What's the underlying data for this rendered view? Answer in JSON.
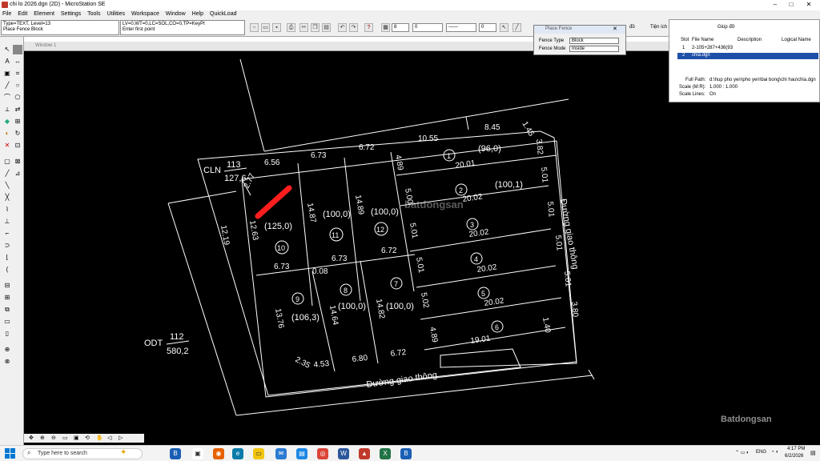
{
  "window": {
    "title": "chi lo 2026.dgn (2D) - MicroStation SE"
  },
  "menu": [
    "File",
    "Edit",
    "Element",
    "Settings",
    "Tools",
    "Utilities",
    "Workspace",
    "Window",
    "Help",
    "QuickLoad"
  ],
  "status": {
    "line1": "Type=TEXT, Level=13",
    "line2": "Place Fence Block",
    "line3": "LV=0,WT=0,LC=SOL,CO=0,TP=KeyPt",
    "line4": "Enter first point"
  },
  "toolbar": {
    "weight_value": "0",
    "color_value": "0",
    "level_value": "8"
  },
  "view": {
    "title": "Window 1"
  },
  "fence_dialog": {
    "title": "Place Fence",
    "type_label": "Fence Type",
    "type_value": "Block",
    "mode_label": "Fence Mode",
    "mode_value": "Inside"
  },
  "reference": {
    "tabs": [
      "đồ",
      "Tiện ích",
      "Giúp đỡ"
    ],
    "headers": [
      "Slot",
      "File Name",
      "Description",
      "Logical Name"
    ],
    "rows": [
      {
        "slot": "1",
        "file": "2-105+287+436(93"
      },
      {
        "slot": "2",
        "file": "chia.dgn"
      }
    ],
    "full_path_label": "Full Path:",
    "full_path": "d:\\hup pho yen\\pho yen\\bai bong\\chi hau\\chia.dgn",
    "scale_label": "Scale (M:R):",
    "scale": "1.000 : 1.000",
    "scale_lines_label": "Scale Lines:",
    "scale_lines": "On"
  },
  "cad": {
    "cln_label": "CLN",
    "cln_top": "113",
    "cln_bottom": "127,6",
    "odt_label": "ODT",
    "odt_top": "112",
    "odt_bottom": "580,2",
    "road_bottom": "Đường giao thông",
    "road_right": "Đường giao thông",
    "plots": [
      {
        "id": "1",
        "area": "(96,0)"
      },
      {
        "id": "2",
        "area": "(100,1)"
      },
      {
        "id": "3",
        "area": ""
      },
      {
        "id": "4",
        "area": ""
      },
      {
        "id": "5",
        "area": ""
      },
      {
        "id": "6",
        "area": ""
      },
      {
        "id": "7",
        "area": "(100,0)"
      },
      {
        "id": "8",
        "area": "(100,0)"
      },
      {
        "id": "9",
        "area": "(106,3)"
      },
      {
        "id": "10",
        "area": "(125,0)"
      },
      {
        "id": "11",
        "area": "(100,0)"
      },
      {
        "id": "12",
        "area": "(100,0)"
      }
    ],
    "dims": {
      "top_656": "6.56",
      "top_673": "6.73",
      "top_672": "6.72",
      "top_1055": "10.55",
      "top_845": "8.45",
      "top_145": "1.45",
      "r_382": "3.82",
      "r_501a": "5.01",
      "r_501b": "5.01",
      "r_501c": "5.01",
      "r_501d": "5.01",
      "r_380": "3.80",
      "s1": "20.01",
      "s2": "20.02",
      "s3": "20.02",
      "s4": "20.02",
      "s5": "20.02",
      "s6": "19.01",
      "i_489": "4.89",
      "i_500": "5.00",
      "i_501a": "5.01",
      "i_501b": "5.01",
      "i_502": "5.02",
      "i_489b": "4.89",
      "i_140": "1.40",
      "l_277": "2.77",
      "l_1263": "12.63",
      "l_1219": "12.19",
      "l_1376": "13.76",
      "l_235": "2.35",
      "m_1487": "14.87",
      "m_1489": "14.89",
      "m_1464": "14.64",
      "m_1482": "14.82",
      "mid_673a": "6.73",
      "mid_008": "0.08",
      "mid_673b": "6.73",
      "mid_672": "6.72",
      "b_453": "4.53",
      "b_680": "6.80",
      "b_672": "6.72"
    }
  },
  "taskbar": {
    "search_placeholder": "Type here to search",
    "lang": "ENG",
    "time": "4:17 PM",
    "date": "6/2/2026"
  },
  "watermark": "Batdongsan",
  "watermark_center": "batdongsan"
}
